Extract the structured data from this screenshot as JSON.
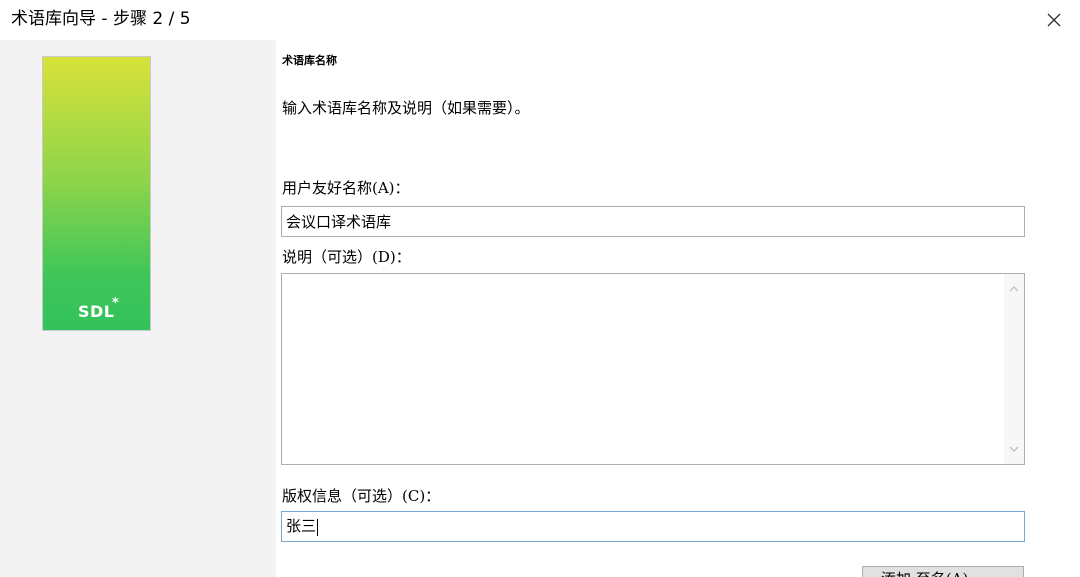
{
  "window": {
    "title": "术语库向导 - 步骤 2 / 5",
    "close_icon": "close-icon"
  },
  "brand": {
    "logo_text": "SDL",
    "logo_star": "*",
    "gradient_top": "#d7e23a",
    "gradient_bottom": "#33c25b"
  },
  "page": {
    "heading": "术语库名称",
    "instruction": "输入术语库名称及说明（如果需要）。"
  },
  "form": {
    "friendly_name": {
      "label": "用户友好名称(A)：",
      "value": "会议口译术语库"
    },
    "description": {
      "label": "说明（可选）(D)：",
      "value": ""
    },
    "copyright": {
      "label": "版权信息（可选）(C)：",
      "value": "张三"
    }
  },
  "footer": {
    "button_label": "添加 至名(A)..."
  },
  "colors": {
    "focus_border": "#7aa7d6",
    "panel_bg": "#f3f3f3"
  }
}
